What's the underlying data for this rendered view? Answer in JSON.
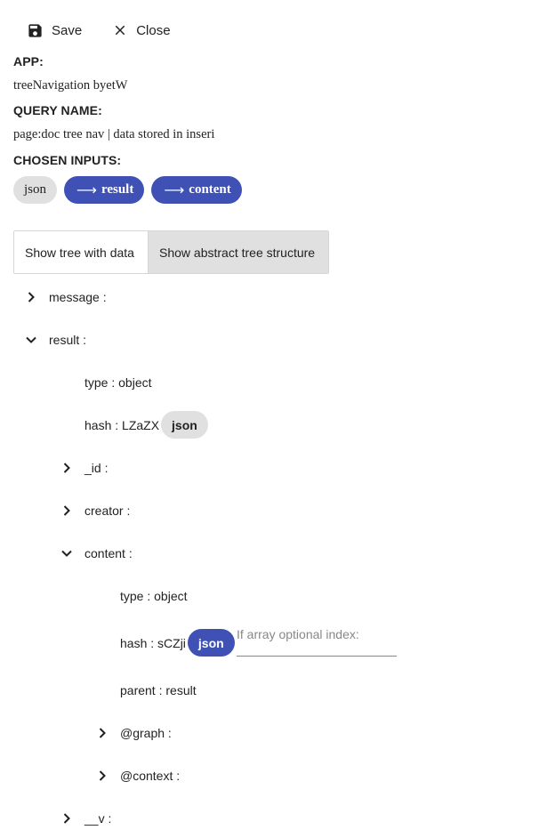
{
  "toolbar": {
    "save_label": "Save",
    "close_label": "Close"
  },
  "meta": {
    "app_label": "APP:",
    "app_value": "treeNavigation byetW",
    "query_label": "QUERY NAME:",
    "query_value": "page:doc tree nav | data stored in inseri",
    "inputs_label": "CHOSEN INPUTS:"
  },
  "chips": [
    {
      "label": "json",
      "type": "plain"
    },
    {
      "label": "result",
      "type": "link",
      "icon": "arrow-right-icon"
    },
    {
      "label": "content",
      "type": "link",
      "icon": "arrow-right-icon"
    }
  ],
  "toggle": {
    "option1": "Show tree with data",
    "option2": "Show abstract tree structure",
    "active": "option2"
  },
  "tree": {
    "message": "message :",
    "result": "result :",
    "result_type": "type : object",
    "result_hash": "hash : LZaZX",
    "result_hash_chip": "json",
    "id": "_id :",
    "creator": "creator :",
    "content": "content :",
    "content_type": "type : object",
    "content_hash": "hash : sCZji",
    "content_hash_chip": "json",
    "index_placeholder": "If array optional index:",
    "content_parent": "parent : result",
    "graph": "@graph :",
    "context": "@context :",
    "v": "__v :"
  },
  "colors": {
    "accent": "#3f51b5",
    "chip_grey": "#e0e0e0"
  }
}
